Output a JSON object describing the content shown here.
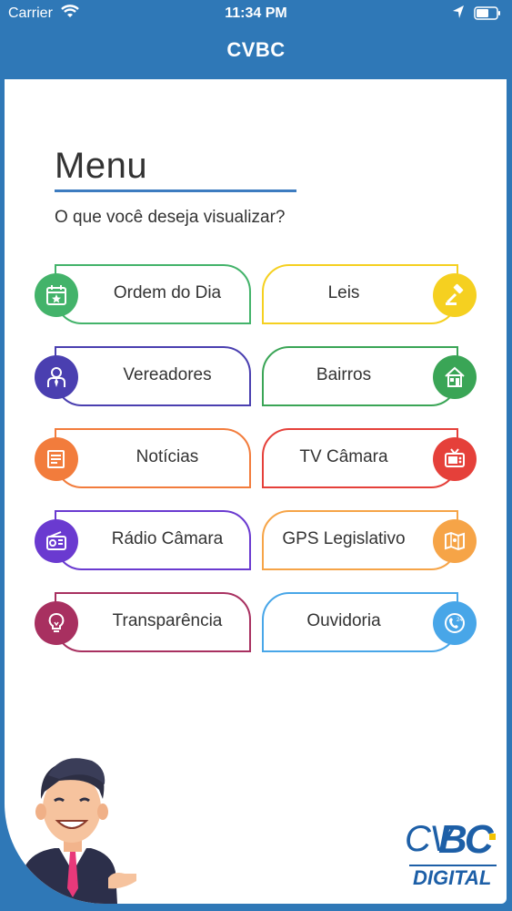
{
  "status": {
    "carrier": "Carrier",
    "time": "11:34 PM"
  },
  "nav": {
    "title": "CVBC"
  },
  "menu": {
    "title": "Menu",
    "subtitle": "O que você deseja visualizar?",
    "items": [
      {
        "label": "Ordem do Dia",
        "color": "#43b36a",
        "icon": "calendar-star-icon"
      },
      {
        "label": "Leis",
        "color": "#f5d020",
        "icon": "gavel-icon"
      },
      {
        "label": "Vereadores",
        "color": "#4a3fb0",
        "icon": "person-icon"
      },
      {
        "label": "Bairros",
        "color": "#3aa556",
        "icon": "house-icon"
      },
      {
        "label": "Notícias",
        "color": "#f27c3c",
        "icon": "newspaper-icon"
      },
      {
        "label": "TV Câmara",
        "color": "#e5403a",
        "icon": "tv-icon"
      },
      {
        "label": "Rádio Câmara",
        "color": "#6a3ad0",
        "icon": "radio-icon"
      },
      {
        "label": "GPS Legislativo",
        "color": "#f6a447",
        "icon": "map-icon"
      },
      {
        "label": "Transparência",
        "color": "#a83060",
        "icon": "lightbulb-icon"
      },
      {
        "label": "Ouvidoria",
        "color": "#48a6e8",
        "icon": "phone-24-icon"
      }
    ]
  },
  "logo": {
    "primary": "CV",
    "secondary": "BC",
    "tagline": "DIGITAL"
  }
}
